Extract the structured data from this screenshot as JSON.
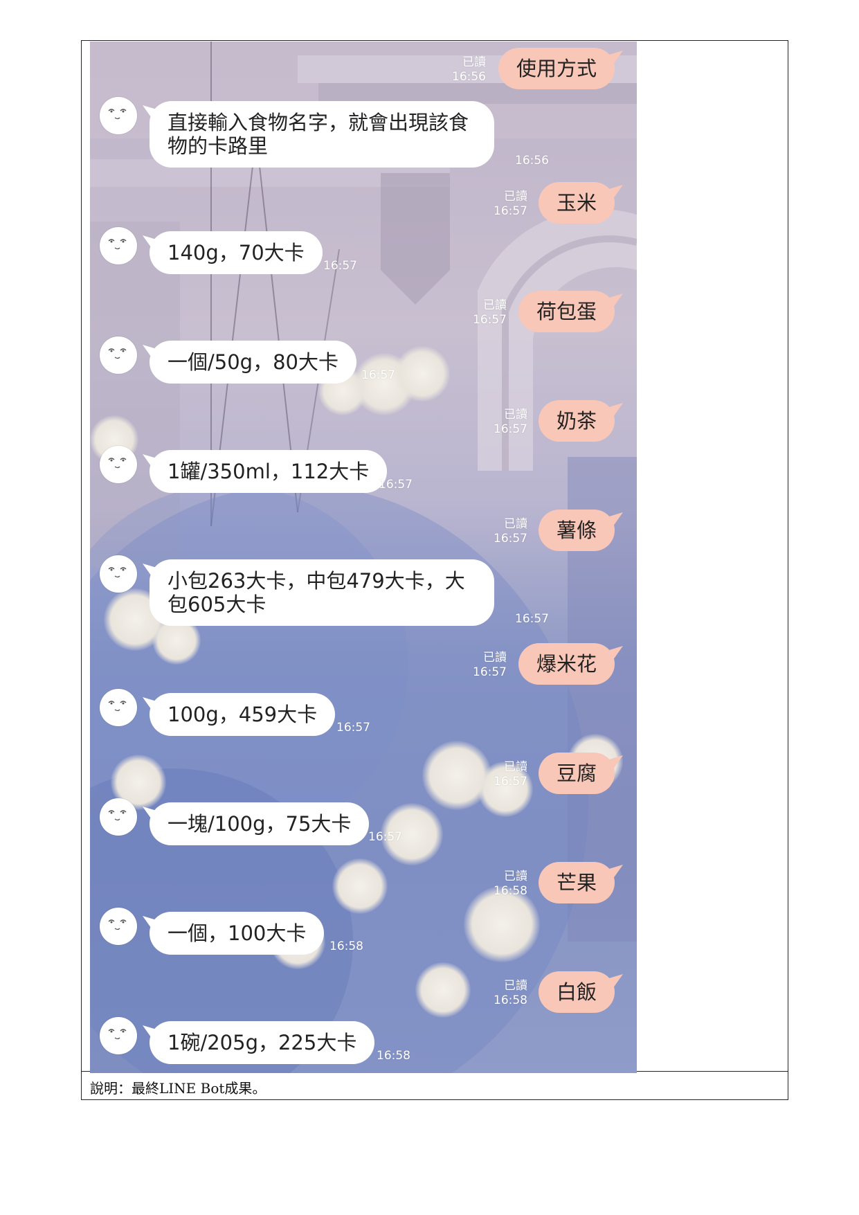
{
  "caption": "說明：最終LINE Bot成果。",
  "chat": {
    "read_label": "已讀",
    "outgoing": [
      {
        "text": "使用方式",
        "time": "16:56"
      },
      {
        "text": "玉米",
        "time": "16:57"
      },
      {
        "text": "荷包蛋",
        "time": "16:57"
      },
      {
        "text": "奶茶",
        "time": "16:57"
      },
      {
        "text": "薯條",
        "time": "16:57"
      },
      {
        "text": "爆米花",
        "time": "16:57"
      },
      {
        "text": "豆腐",
        "time": "16:57"
      },
      {
        "text": "芒果",
        "time": "16:58"
      },
      {
        "text": "白飯",
        "time": "16:58"
      }
    ],
    "incoming": [
      {
        "line1": "直接輸入食物名字，就會出現該食",
        "line2": "物的卡路里",
        "time": "16:56"
      },
      {
        "text": "140g，70大卡",
        "time": "16:57"
      },
      {
        "text": "一個/50g，80大卡",
        "time": "16:57"
      },
      {
        "text": "1罐/350ml，112大卡",
        "time": "16:57"
      },
      {
        "line1": "小包263大卡，中包479大卡，大",
        "line2": "包605大卡",
        "time": "16:57"
      },
      {
        "text": "100g，459大卡",
        "time": "16:57"
      },
      {
        "text": "一塊/100g，75大卡",
        "time": "16:57"
      },
      {
        "text": "一個，100大卡",
        "time": "16:58"
      },
      {
        "text": "1碗/205g，225大卡",
        "time": "16:58"
      }
    ]
  },
  "colors": {
    "outgoing_bubble": "#f9c7b8",
    "incoming_bubble": "#ffffff",
    "timestamp": "#ffffff"
  },
  "icons": {
    "avatar": "bot-face-icon"
  }
}
